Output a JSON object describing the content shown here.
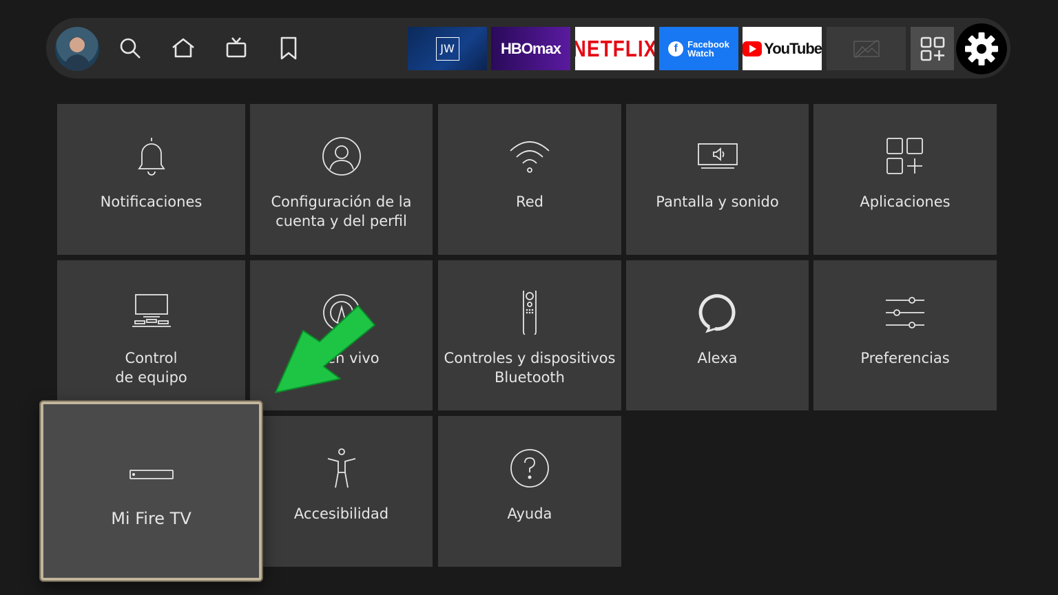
{
  "topbar": {
    "apps": {
      "jw": "JW",
      "hbo": "HBOmax",
      "netflix": "NETFLIX",
      "facebook_line1": "Facebook",
      "facebook_line2": "Watch",
      "youtube": "YouTube"
    },
    "icons": [
      "profile-avatar",
      "search-icon",
      "home-icon",
      "live-tv-icon",
      "bookmark-icon",
      "apps-grid-icon",
      "gear-icon"
    ]
  },
  "settings": {
    "items": [
      {
        "label": "Notificaciones",
        "icon": "bell-icon"
      },
      {
        "label": "Configuración de la\ncuenta y del perfil",
        "icon": "user-circle-icon"
      },
      {
        "label": "Red",
        "icon": "wifi-icon"
      },
      {
        "label": "Pantalla y sonido",
        "icon": "display-sound-icon"
      },
      {
        "label": "Aplicaciones",
        "icon": "apps-icon"
      },
      {
        "label": "Control\nde equipo",
        "icon": "equipment-icon"
      },
      {
        "label": "TV en vivo",
        "icon": "antenna-icon"
      },
      {
        "label": "Controles y dispositivos\nBluetooth",
        "icon": "remote-icon"
      },
      {
        "label": "Alexa",
        "icon": "alexa-ring-icon"
      },
      {
        "label": "Preferencias",
        "icon": "sliders-icon"
      },
      {
        "label": "Mi Fire TV",
        "icon": "fire-tv-stick-icon"
      },
      {
        "label": "Accesibilidad",
        "icon": "accessibility-icon"
      },
      {
        "label": "Ayuda",
        "icon": "help-icon"
      }
    ],
    "focused": "Mi Fire TV"
  },
  "colors": {
    "background": "#1a1a1a",
    "card": "#3a3a3a",
    "focus_border": "#c2b59b",
    "arrow": "#1ec545"
  }
}
